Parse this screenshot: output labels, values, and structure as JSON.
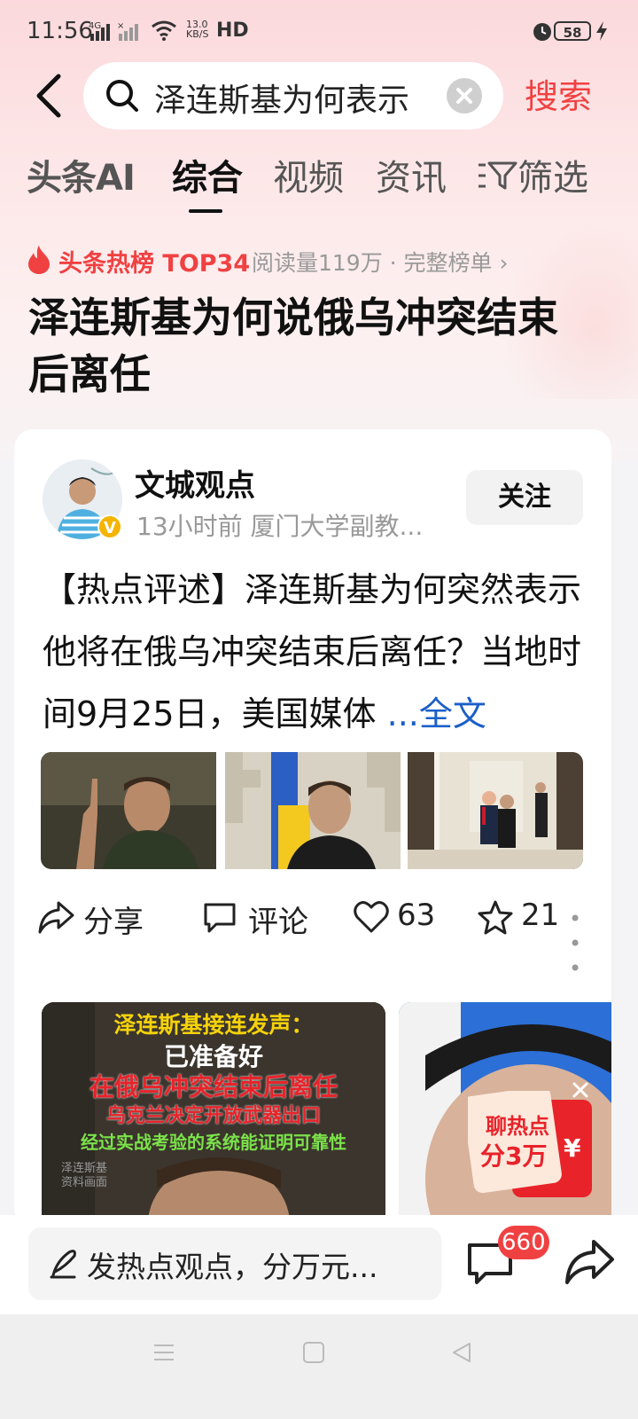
{
  "status_bar": {
    "time": "11:56",
    "network_label": "4G",
    "speed_value": "13.0",
    "speed_unit": "KB/S",
    "hd_label": "HD",
    "battery": "58"
  },
  "search": {
    "query": "泽连斯基为何表示",
    "search_button": "搜索"
  },
  "tabs": {
    "ai": "头条AI",
    "active": "综合",
    "video": "视频",
    "news": "资讯",
    "filter": "筛选"
  },
  "hot": {
    "label": "头条热榜 TOP34",
    "meta": "阅读量119万 · 完整榜单 ›"
  },
  "headline": "泽连斯基为何说俄乌冲突结束后离任",
  "post": {
    "author": "文城观点",
    "badge": "V",
    "meta": "13小时前  厦门大学副教...",
    "follow": "关注",
    "text": "【热点评述】泽连斯基为何突然表示他将在俄乌冲突结束后离任？当地时间9月25日，美国媒体 ",
    "more_link": "...全文",
    "actions": {
      "share": "分享",
      "comment": "评论",
      "likes": "63",
      "favorites": "21"
    }
  },
  "video1": {
    "line1": "泽连斯基接连发声：",
    "line2": "已准备好",
    "line3": "在俄乌冲突结束后离任",
    "line4": "乌克兰决定开放武器出口",
    "line5": "经过实战考验的系统能证明可靠性",
    "watermark1": "泽连斯基",
    "watermark2": "资料画面"
  },
  "red_packet": {
    "line1": "聊热点",
    "line2": "分3万",
    "symbol": "¥"
  },
  "bottom": {
    "placeholder": "发热点观点，分万元...",
    "comment_count": "660"
  },
  "colors": {
    "accent": "#f04142",
    "link": "#1b5fc8"
  }
}
